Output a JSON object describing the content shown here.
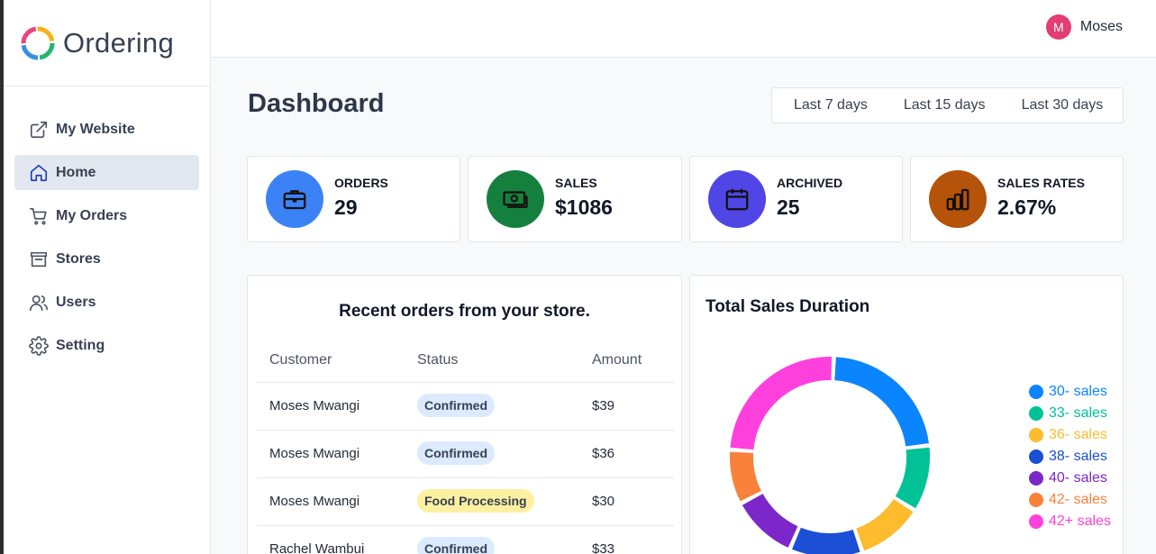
{
  "brand": {
    "name": "Ordering"
  },
  "user": {
    "initial": "M",
    "name": "Moses"
  },
  "nav": [
    {
      "label": "My Website",
      "icon": "external-link-icon"
    },
    {
      "label": "Home",
      "icon": "home-icon"
    },
    {
      "label": "My Orders",
      "icon": "cart-icon"
    },
    {
      "label": "Stores",
      "icon": "store-icon"
    },
    {
      "label": "Users",
      "icon": "users-icon"
    },
    {
      "label": "Setting",
      "icon": "gear-icon"
    }
  ],
  "page": {
    "title": "Dashboard"
  },
  "ranges": [
    "Last 7 days",
    "Last 15 days",
    "Last 30 days"
  ],
  "stats": [
    {
      "label": "ORDERS",
      "value": "29",
      "icon": "briefcase-icon",
      "color": "#3b82f6"
    },
    {
      "label": "SALES",
      "value": "$1086",
      "icon": "cash-icon",
      "color": "#15803d"
    },
    {
      "label": "ARCHIVED",
      "value": "25",
      "icon": "calendar-icon",
      "color": "#4f46e5"
    },
    {
      "label": "SALES RATES",
      "value": "2.67%",
      "icon": "bar-chart-icon",
      "color": "#b45309"
    }
  ],
  "orders": {
    "title": "Recent orders from your store.",
    "columns": [
      "Customer",
      "Status",
      "Amount"
    ],
    "rows": [
      {
        "customer": "Moses Mwangi",
        "status": "Confirmed",
        "amount": "$39",
        "status_bg": "#dbeafe",
        "status_fg": "#374151"
      },
      {
        "customer": "Moses Mwangi",
        "status": "Confirmed",
        "amount": "$36",
        "status_bg": "#dbeafe",
        "status_fg": "#374151"
      },
      {
        "customer": "Moses Mwangi",
        "status": "Food Processing",
        "amount": "$30",
        "status_bg": "#fdf0a0",
        "status_fg": "#374151"
      },
      {
        "customer": "Rachel Wambui",
        "status": "Confirmed",
        "amount": "$33",
        "status_bg": "#dbeafe",
        "status_fg": "#374151"
      }
    ]
  },
  "sales_chart": {
    "title": "Total Sales Duration"
  },
  "chart_data": {
    "type": "pie",
    "title": "Total Sales Duration",
    "categories": [
      "30- sales",
      "33- sales",
      "36- sales",
      "38- sales",
      "40- sales",
      "42- sales",
      "42+ sales"
    ],
    "values": [
      23,
      11,
      11,
      12,
      11,
      9,
      25
    ],
    "colors": [
      "#0b84ff",
      "#00c296",
      "#fdbb2d",
      "#1a4fd6",
      "#7b27c9",
      "#f9813a",
      "#ff40dd"
    ],
    "legend_position": "right"
  }
}
